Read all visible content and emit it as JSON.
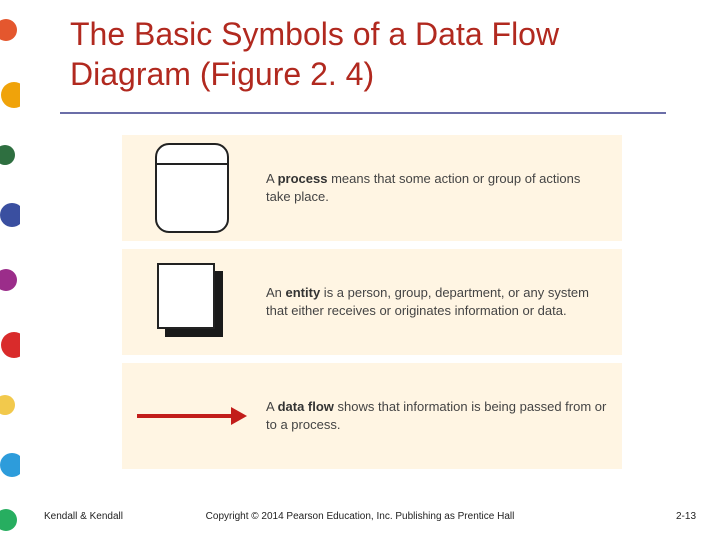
{
  "title": "The Basic Symbols of a Data Flow Diagram (Figure 2. 4)",
  "rows": [
    {
      "lead": "A ",
      "bold": "process",
      "tail": " means that some action or group of actions take place."
    },
    {
      "lead": "An ",
      "bold": "entity",
      "tail": " is a person, group, department, or any system that either receives or originates information or data."
    },
    {
      "lead": "A ",
      "bold": "data flow",
      "tail": " shows that information is being passed from or to a process."
    }
  ],
  "footer": {
    "author": "Kendall & Kendall",
    "copyright": "Copyright © 2014 Pearson Education, Inc. Publishing as Prentice Hall",
    "page": "2-13"
  },
  "sidebar_colors": [
    "#e4572e",
    "#f0a30a",
    "#2e6f40",
    "#3a4fa0",
    "#9b2d8a",
    "#d92b2b",
    "#f2c94c",
    "#2d9cdb",
    "#27ae60"
  ]
}
